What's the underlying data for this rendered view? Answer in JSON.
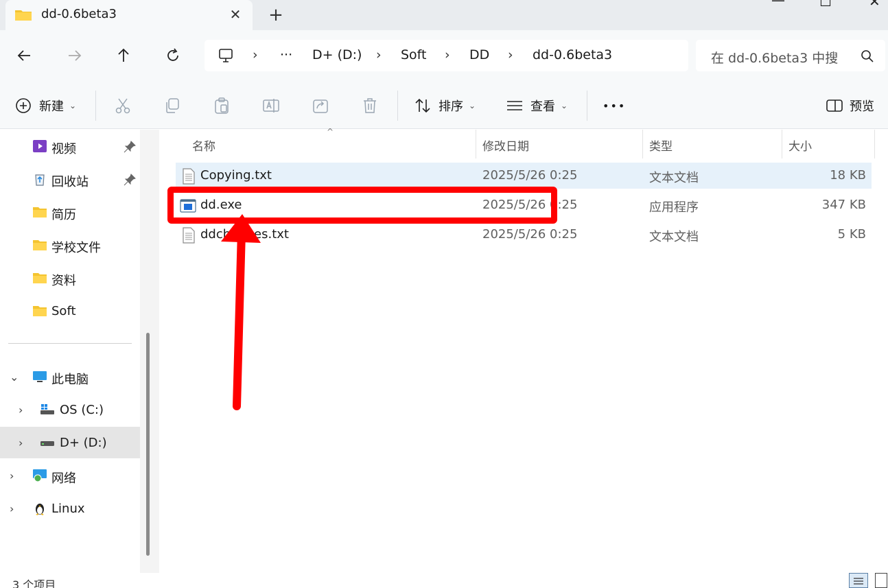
{
  "tab": {
    "title": "dd-0.6beta3",
    "close": "✕",
    "new": "+"
  },
  "window": {
    "minimize": "—",
    "maximize": "☐",
    "close": "✕"
  },
  "address": {
    "ellipsis": "···",
    "crumbs": [
      "D+ (D:)",
      "Soft",
      "DD",
      "dd-0.6beta3"
    ],
    "search_placeholder": "在 dd-0.6beta3 中搜"
  },
  "toolbar": {
    "new_label": "新建",
    "sort_label": "排序",
    "view_label": "查看",
    "more": "•••",
    "preview_label": "预览"
  },
  "sidebar": {
    "quick": [
      {
        "label": "视频",
        "icon": "video-folder-icon",
        "pinned": true
      },
      {
        "label": "回收站",
        "icon": "recycle-bin-icon",
        "pinned": true
      },
      {
        "label": "简历",
        "icon": "folder-icon",
        "pinned": false
      },
      {
        "label": "学校文件",
        "icon": "folder-icon",
        "pinned": false
      },
      {
        "label": "资料",
        "icon": "folder-icon",
        "pinned": false
      },
      {
        "label": "Soft",
        "icon": "folder-icon",
        "pinned": false
      }
    ],
    "this_pc": "此电脑",
    "drives": [
      {
        "label": "OS (C:)"
      },
      {
        "label": "D+ (D:)"
      }
    ],
    "network": "网络",
    "linux": "Linux"
  },
  "columns": {
    "name": "名称",
    "modified": "修改日期",
    "type": "类型",
    "size": "大小"
  },
  "files": [
    {
      "name": "Copying.txt",
      "modified": "2025/5/26 0:25",
      "type": "文本文档",
      "size": "18 KB",
      "icon": "text-file-icon"
    },
    {
      "name": "dd.exe",
      "modified": "2025/5/26 0:25",
      "type": "应用程序",
      "size": "347 KB",
      "icon": "app-exe-icon"
    },
    {
      "name": "ddchanges.txt",
      "modified": "2025/5/26 0:25",
      "type": "文本文档",
      "size": "5 KB",
      "icon": "text-file-icon"
    }
  ],
  "status": {
    "count": "3 个项目"
  },
  "colors": {
    "annotation": "#ff0000",
    "hover_row": "#e6f1fa",
    "selected_nav": "#e5e5e5"
  }
}
